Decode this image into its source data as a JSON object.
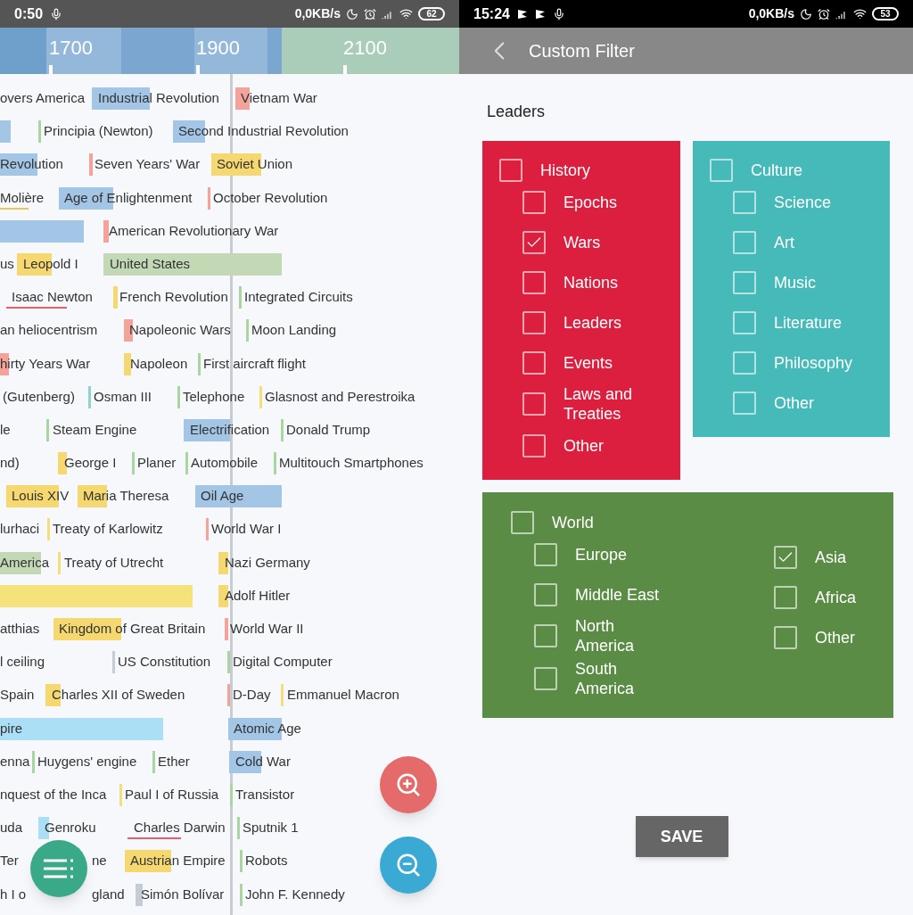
{
  "timeline_screen": {
    "status_bar": {
      "time": "0:50",
      "net_speed": "0,0KB/s",
      "battery": "62"
    },
    "axis_labels": [
      "1700",
      "1900",
      "2100"
    ],
    "rows": [
      [
        {
          "text": "overs America",
          "kind": "plain"
        },
        {
          "text": "Industrial Revolution",
          "kind": "bar",
          "color": "#a3c6e6"
        },
        {
          "text": "Vietnam War",
          "kind": "bar",
          "color": "#f4a39b"
        }
      ],
      [
        {
          "kind": "bar",
          "color": "#a3c6e6"
        },
        {
          "text": "Principia (Newton)",
          "kind": "line",
          "color": "#a9d59f"
        },
        {
          "text": "Second Industrial Revolution",
          "kind": "bar",
          "color": "#a3c6e6"
        }
      ],
      [
        {
          "text": "Revolution",
          "kind": "bar",
          "color": "#a3c6e6"
        },
        {
          "text": "Seven Years' War",
          "kind": "line",
          "color": "#f4a39b"
        },
        {
          "text": "Soviet Union",
          "kind": "bar",
          "color": "#f5d970"
        }
      ],
      [
        {
          "text": "Molière",
          "kind": "underline",
          "color": "#e8c75a"
        },
        {
          "text": "Age of Enlightenment",
          "kind": "bar",
          "color": "#a3c6e6"
        },
        {
          "text": "October Revolution",
          "kind": "line",
          "color": "#f4a39b"
        }
      ],
      [
        {
          "kind": "bar",
          "color": "#a3c6e6"
        },
        {
          "text": "American Revolutionary War",
          "kind": "bar",
          "color": "#f4a39b"
        }
      ],
      [
        {
          "text": "us",
          "kind": "plain"
        },
        {
          "text": "Leopold I",
          "kind": "bar",
          "color": "#f5d970"
        },
        {
          "text": "United States",
          "kind": "bar",
          "color": "#c3d9b6"
        }
      ],
      [
        {
          "text": "Isaac Newton",
          "kind": "underline",
          "color": "#e06070"
        },
        {
          "text": "French Revolution",
          "kind": "bar",
          "color": "#f5d970"
        },
        {
          "text": "Integrated Circuits",
          "kind": "line",
          "color": "#a9d59f"
        }
      ],
      [
        {
          "text": "an heliocentrism",
          "kind": "plain"
        },
        {
          "text": "Napoleonic Wars",
          "kind": "bar",
          "color": "#f4a39b"
        },
        {
          "text": "Moon Landing",
          "kind": "line",
          "color": "#a9d59f"
        }
      ],
      [
        {
          "text": "hirty Years War",
          "kind": "bar",
          "color": "#f4a39b"
        },
        {
          "text": "Napoleon",
          "kind": "bar",
          "color": "#f5d970"
        },
        {
          "text": "First aircraft flight",
          "kind": "line",
          "color": "#a9d59f"
        }
      ],
      [
        {
          "text": "(Gutenberg)",
          "kind": "plain"
        },
        {
          "text": "Osman III",
          "kind": "line",
          "color": "#8fd3cc"
        },
        {
          "text": "Telephone",
          "kind": "line",
          "color": "#a9d59f"
        },
        {
          "text": "Glasnost and Perestroika",
          "kind": "line",
          "color": "#f3df7a"
        }
      ],
      [
        {
          "text": "le",
          "kind": "plain"
        },
        {
          "text": "Steam Engine",
          "kind": "line",
          "color": "#a9d59f"
        },
        {
          "text": "Electrification",
          "kind": "bar",
          "color": "#a3c6e6"
        },
        {
          "text": "Donald Trump",
          "kind": "line",
          "color": "#a9d59f"
        }
      ],
      [
        {
          "text": "nd)",
          "kind": "plain"
        },
        {
          "text": "George I",
          "kind": "bar",
          "color": "#f5d970"
        },
        {
          "text": "Planer",
          "kind": "line",
          "color": "#a9d59f"
        },
        {
          "text": "Automobile",
          "kind": "line",
          "color": "#a9d59f"
        },
        {
          "text": "Multitouch Smartphones",
          "kind": "line",
          "color": "#a9d59f"
        }
      ],
      [
        {
          "text": "Louis XIV",
          "kind": "bar",
          "color": "#f5d970"
        },
        {
          "text": "Maria Theresa",
          "kind": "bar",
          "color": "#f5d970"
        },
        {
          "text": "Oil Age",
          "kind": "bar",
          "color": "#a3c6e6"
        }
      ],
      [
        {
          "text": "lurhaci",
          "kind": "plain"
        },
        {
          "text": "Treaty of Karlowitz",
          "kind": "line",
          "color": "#f3df7a"
        },
        {
          "text": "World War I",
          "kind": "line",
          "color": "#f4a39b"
        }
      ],
      [
        {
          "text": "America",
          "kind": "bar",
          "color": "#c3d9b6"
        },
        {
          "text": "Treaty of Utrecht",
          "kind": "line",
          "color": "#f3df7a"
        },
        {
          "text": "Nazi Germany",
          "kind": "bar",
          "color": "#f5d970"
        }
      ],
      [
        {
          "kind": "bar",
          "color": "#f5e27a"
        },
        {
          "text": "Adolf Hitler",
          "kind": "bar",
          "color": "#f5d970"
        }
      ],
      [
        {
          "text": "atthias",
          "kind": "plain"
        },
        {
          "text": "Kingdom of Great Britain",
          "kind": "bar",
          "color": "#f5d970"
        },
        {
          "text": "World War II",
          "kind": "line",
          "color": "#f4a39b"
        }
      ],
      [
        {
          "text": "l ceiling",
          "kind": "plain"
        },
        {
          "text": "US Constitution",
          "kind": "line",
          "color": "#c5ccd3"
        },
        {
          "text": "Digital Computer",
          "kind": "line",
          "color": "#a9d59f"
        }
      ],
      [
        {
          "text": "Spain",
          "kind": "plain"
        },
        {
          "text": "Charles XII of Sweden",
          "kind": "bar",
          "color": "#f5d970"
        },
        {
          "text": "D-Day",
          "kind": "line",
          "color": "#f4a39b"
        },
        {
          "text": "Emmanuel Macron",
          "kind": "line",
          "color": "#f3df7a"
        }
      ],
      [
        {
          "text": "pire",
          "kind": "bar",
          "color": "#aadff5"
        },
        {
          "text": "Atomic Age",
          "kind": "bar",
          "color": "#a3c6e6"
        }
      ],
      [
        {
          "text": "enna",
          "kind": "plain"
        },
        {
          "text": "Huygens' engine",
          "kind": "line",
          "color": "#a9d59f"
        },
        {
          "text": "Ether",
          "kind": "line",
          "color": "#a9d59f"
        },
        {
          "text": "Cold War",
          "kind": "bar",
          "color": "#a3c6e6"
        }
      ],
      [
        {
          "text": "nquest of the Inca",
          "kind": "plain"
        },
        {
          "text": "Paul I of Russia",
          "kind": "line",
          "color": "#f3df7a"
        },
        {
          "text": "Transistor",
          "kind": "line",
          "color": "#a9d59f"
        }
      ],
      [
        {
          "text": "uda",
          "kind": "plain"
        },
        {
          "text": "Genroku",
          "kind": "bar",
          "color": "#aadff5"
        },
        {
          "text": "Charles Darwin",
          "kind": "underline",
          "color": "#e06070"
        },
        {
          "text": "Sputnik 1",
          "kind": "line",
          "color": "#a9d59f"
        }
      ],
      [
        {
          "text": "Ter",
          "kind": "plain"
        },
        {
          "text": "ne",
          "kind": "plain"
        },
        {
          "text": "Austrian Empire",
          "kind": "bar",
          "color": "#f5d970"
        },
        {
          "text": "Robots",
          "kind": "line",
          "color": "#a9d59f"
        }
      ],
      [
        {
          "text": "h I o",
          "kind": "plain"
        },
        {
          "text": "gland",
          "kind": "plain"
        },
        {
          "text": "Simón Bolívar",
          "kind": "bar",
          "color": "#c5ccd3"
        },
        {
          "text": "John F. Kennedy",
          "kind": "line",
          "color": "#a9d59f"
        }
      ]
    ]
  },
  "filter_screen": {
    "status_bar": {
      "time": "15:24",
      "net_speed": "0,0KB/s",
      "battery": "53"
    },
    "app_bar": {
      "title": "Custom Filter"
    },
    "section_title": "Leaders",
    "groups": [
      {
        "label": "History",
        "checked": false,
        "color": "#dc1f3e",
        "columns": [
          [
            {
              "label": "Epochs",
              "checked": false
            },
            {
              "label": "Wars",
              "checked": true
            },
            {
              "label": "Nations",
              "checked": false
            },
            {
              "label": "Leaders",
              "checked": false
            },
            {
              "label": "Events",
              "checked": false
            },
            {
              "label": "Laws and Treaties",
              "checked": false
            },
            {
              "label": "Other",
              "checked": false
            }
          ]
        ]
      },
      {
        "label": "Culture",
        "checked": false,
        "color": "#46b9b9",
        "columns": [
          [
            {
              "label": "Science",
              "checked": false
            },
            {
              "label": "Art",
              "checked": false
            },
            {
              "label": "Music",
              "checked": false
            },
            {
              "label": "Literature",
              "checked": false
            },
            {
              "label": "Philosophy",
              "checked": false
            },
            {
              "label": "Other",
              "checked": false
            }
          ]
        ]
      },
      {
        "label": "World",
        "checked": false,
        "color": "#5b8c45",
        "columns": [
          [
            {
              "label": "Europe",
              "checked": false
            },
            {
              "label": "Middle East",
              "checked": false
            },
            {
              "label": "North America",
              "checked": false
            },
            {
              "label": "South America",
              "checked": false
            }
          ],
          [
            {
              "label": "Asia",
              "checked": true
            },
            {
              "label": "Africa",
              "checked": false
            },
            {
              "label": "Other",
              "checked": false
            }
          ]
        ]
      }
    ],
    "save_button": "SAVE"
  }
}
